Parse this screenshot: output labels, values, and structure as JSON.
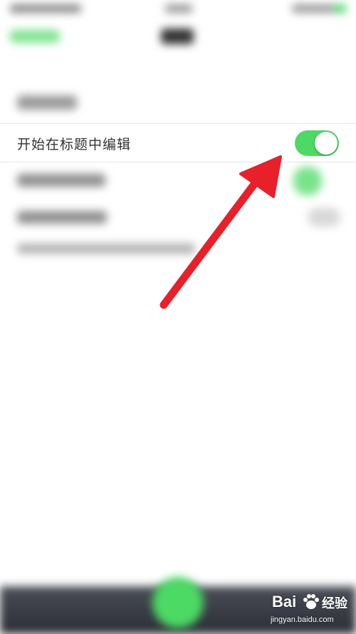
{
  "settings": {
    "edit_in_title": {
      "label": "开始在标题中编辑",
      "enabled": true
    }
  },
  "colors": {
    "toggle_on": "#4cd964",
    "arrow": "#e8202a",
    "bottom_bar": "#3a3d45"
  },
  "icons": {
    "toggle": "switch-icon",
    "annotation": "red-arrow-annotation"
  },
  "watermark": {
    "brand": "Bai",
    "brand_cn": "经验",
    "url": "jingyan.baidu.com"
  }
}
